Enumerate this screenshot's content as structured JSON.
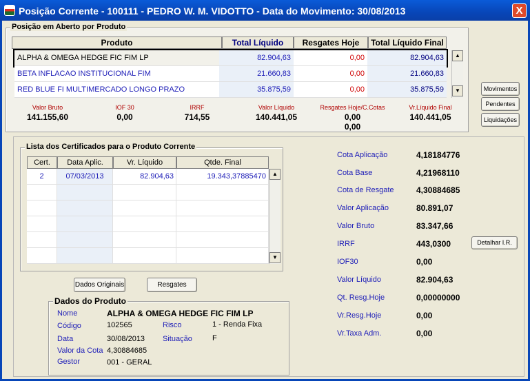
{
  "window": {
    "title": "Posição Corrente - 100111 - PEDRO W. M. VIDOTTO - Data do Movimento: 30/08/2013",
    "close": "X"
  },
  "open_position": {
    "legend": "Posição em Aberto por Produto",
    "columns": [
      "Produto",
      "Total Líquido",
      "Resgates Hoje",
      "Total Líquido Final"
    ],
    "rows": [
      {
        "produto": "ALPHA & OMEGA HEDGE FIC FIM LP",
        "total": "82.904,63",
        "resgates": "0,00",
        "final": "82.904,63"
      },
      {
        "produto": "BETA INFLACAO INSTITUCIONAL FIM",
        "total": "21.660,83",
        "resgates": "0,00",
        "final": "21.660,83"
      },
      {
        "produto": "RED BLUE FI MULTIMERCADO LONGO PRAZO",
        "total": "35.875,59",
        "resgates": "0,00",
        "final": "35.875,59"
      }
    ],
    "totals": [
      {
        "label": "Valor Bruto",
        "value": "141.155,60"
      },
      {
        "label": "IOF 30",
        "value": "0,00"
      },
      {
        "label": "IRRF",
        "value": "714,55"
      },
      {
        "label": "Valor Líquido",
        "value": "140.441,05"
      },
      {
        "label": "Resgates Hoje/C.Cotas",
        "value": "0,00",
        "value2": "0,00"
      },
      {
        "label": "Vr.Líquido Final",
        "value": "140.441,05"
      }
    ]
  },
  "side_buttons": {
    "movimentos": "Movimentos",
    "pendentes": "Pendentes",
    "liquidacoes": "Liquidações"
  },
  "certificates": {
    "legend": "Lista dos Certificados para o Produto Corrente",
    "columns": [
      "Cert.",
      "Data Aplic.",
      "Vr. Líquido",
      "Qtde. Final"
    ],
    "rows": [
      {
        "cert": "2",
        "data": "07/03/2013",
        "valor": "82.904,63",
        "qtde": "19.343,37885470"
      }
    ]
  },
  "buttons": {
    "dados_originais": "Dados Originais",
    "resgates": "Resgates",
    "detalhar": "Detalhar I.R."
  },
  "product": {
    "legend": "Dados do Produto",
    "nome_label": "Nome",
    "nome": "ALPHA & OMEGA HEDGE FIC FIM LP",
    "codigo_label": "Código",
    "codigo": "102565",
    "risco_label": "Risco",
    "risco": "1 - Renda Fixa",
    "data_label": "Data",
    "data": "30/08/2013",
    "situacao_label": "Situação",
    "situacao": "F",
    "valor_cota_label": "Valor da Cota",
    "valor_cota": "4,30884685",
    "gestor_label": "Gestor",
    "gestor": "001 - GERAL"
  },
  "details": [
    {
      "label": "Cota Aplicação",
      "value": "4,18184776"
    },
    {
      "label": "Cota Base",
      "value": "4,21968110"
    },
    {
      "label": "Cota de Resgate",
      "value": "4,30884685"
    },
    {
      "label": "Valor Aplicação",
      "value": "80.891,07"
    },
    {
      "label": "Valor Bruto",
      "value": "83.347,66"
    },
    {
      "label": "IRRF",
      "value": "443,0300"
    },
    {
      "label": "IOF30",
      "value": "0,00"
    },
    {
      "label": "Valor Líquido",
      "value": "82.904,63"
    },
    {
      "label": "Qt. Resg.Hoje",
      "value": "0,00000000"
    },
    {
      "label": "Vr.Resg.Hoje",
      "value": "0,00"
    },
    {
      "label": "Vr.Taxa Adm.",
      "value": "0,00"
    }
  ]
}
